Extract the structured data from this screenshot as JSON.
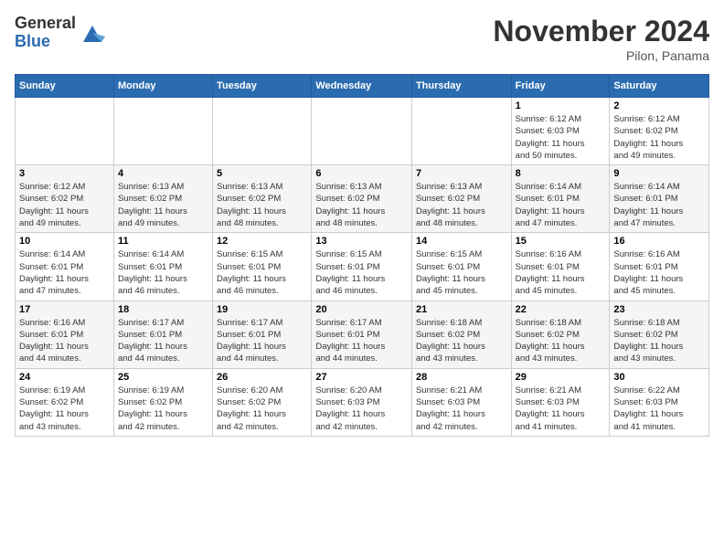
{
  "logo": {
    "general": "General",
    "blue": "Blue"
  },
  "title": "November 2024",
  "subtitle": "Pilon, Panama",
  "days_of_week": [
    "Sunday",
    "Monday",
    "Tuesday",
    "Wednesday",
    "Thursday",
    "Friday",
    "Saturday"
  ],
  "weeks": [
    [
      {
        "day": "",
        "info": ""
      },
      {
        "day": "",
        "info": ""
      },
      {
        "day": "",
        "info": ""
      },
      {
        "day": "",
        "info": ""
      },
      {
        "day": "",
        "info": ""
      },
      {
        "day": "1",
        "info": "Sunrise: 6:12 AM\nSunset: 6:03 PM\nDaylight: 11 hours\nand 50 minutes."
      },
      {
        "day": "2",
        "info": "Sunrise: 6:12 AM\nSunset: 6:02 PM\nDaylight: 11 hours\nand 49 minutes."
      }
    ],
    [
      {
        "day": "3",
        "info": "Sunrise: 6:12 AM\nSunset: 6:02 PM\nDaylight: 11 hours\nand 49 minutes."
      },
      {
        "day": "4",
        "info": "Sunrise: 6:13 AM\nSunset: 6:02 PM\nDaylight: 11 hours\nand 49 minutes."
      },
      {
        "day": "5",
        "info": "Sunrise: 6:13 AM\nSunset: 6:02 PM\nDaylight: 11 hours\nand 48 minutes."
      },
      {
        "day": "6",
        "info": "Sunrise: 6:13 AM\nSunset: 6:02 PM\nDaylight: 11 hours\nand 48 minutes."
      },
      {
        "day": "7",
        "info": "Sunrise: 6:13 AM\nSunset: 6:02 PM\nDaylight: 11 hours\nand 48 minutes."
      },
      {
        "day": "8",
        "info": "Sunrise: 6:14 AM\nSunset: 6:01 PM\nDaylight: 11 hours\nand 47 minutes."
      },
      {
        "day": "9",
        "info": "Sunrise: 6:14 AM\nSunset: 6:01 PM\nDaylight: 11 hours\nand 47 minutes."
      }
    ],
    [
      {
        "day": "10",
        "info": "Sunrise: 6:14 AM\nSunset: 6:01 PM\nDaylight: 11 hours\nand 47 minutes."
      },
      {
        "day": "11",
        "info": "Sunrise: 6:14 AM\nSunset: 6:01 PM\nDaylight: 11 hours\nand 46 minutes."
      },
      {
        "day": "12",
        "info": "Sunrise: 6:15 AM\nSunset: 6:01 PM\nDaylight: 11 hours\nand 46 minutes."
      },
      {
        "day": "13",
        "info": "Sunrise: 6:15 AM\nSunset: 6:01 PM\nDaylight: 11 hours\nand 46 minutes."
      },
      {
        "day": "14",
        "info": "Sunrise: 6:15 AM\nSunset: 6:01 PM\nDaylight: 11 hours\nand 45 minutes."
      },
      {
        "day": "15",
        "info": "Sunrise: 6:16 AM\nSunset: 6:01 PM\nDaylight: 11 hours\nand 45 minutes."
      },
      {
        "day": "16",
        "info": "Sunrise: 6:16 AM\nSunset: 6:01 PM\nDaylight: 11 hours\nand 45 minutes."
      }
    ],
    [
      {
        "day": "17",
        "info": "Sunrise: 6:16 AM\nSunset: 6:01 PM\nDaylight: 11 hours\nand 44 minutes."
      },
      {
        "day": "18",
        "info": "Sunrise: 6:17 AM\nSunset: 6:01 PM\nDaylight: 11 hours\nand 44 minutes."
      },
      {
        "day": "19",
        "info": "Sunrise: 6:17 AM\nSunset: 6:01 PM\nDaylight: 11 hours\nand 44 minutes."
      },
      {
        "day": "20",
        "info": "Sunrise: 6:17 AM\nSunset: 6:01 PM\nDaylight: 11 hours\nand 44 minutes."
      },
      {
        "day": "21",
        "info": "Sunrise: 6:18 AM\nSunset: 6:02 PM\nDaylight: 11 hours\nand 43 minutes."
      },
      {
        "day": "22",
        "info": "Sunrise: 6:18 AM\nSunset: 6:02 PM\nDaylight: 11 hours\nand 43 minutes."
      },
      {
        "day": "23",
        "info": "Sunrise: 6:18 AM\nSunset: 6:02 PM\nDaylight: 11 hours\nand 43 minutes."
      }
    ],
    [
      {
        "day": "24",
        "info": "Sunrise: 6:19 AM\nSunset: 6:02 PM\nDaylight: 11 hours\nand 43 minutes."
      },
      {
        "day": "25",
        "info": "Sunrise: 6:19 AM\nSunset: 6:02 PM\nDaylight: 11 hours\nand 42 minutes."
      },
      {
        "day": "26",
        "info": "Sunrise: 6:20 AM\nSunset: 6:02 PM\nDaylight: 11 hours\nand 42 minutes."
      },
      {
        "day": "27",
        "info": "Sunrise: 6:20 AM\nSunset: 6:03 PM\nDaylight: 11 hours\nand 42 minutes."
      },
      {
        "day": "28",
        "info": "Sunrise: 6:21 AM\nSunset: 6:03 PM\nDaylight: 11 hours\nand 42 minutes."
      },
      {
        "day": "29",
        "info": "Sunrise: 6:21 AM\nSunset: 6:03 PM\nDaylight: 11 hours\nand 41 minutes."
      },
      {
        "day": "30",
        "info": "Sunrise: 6:22 AM\nSunset: 6:03 PM\nDaylight: 11 hours\nand 41 minutes."
      }
    ]
  ]
}
